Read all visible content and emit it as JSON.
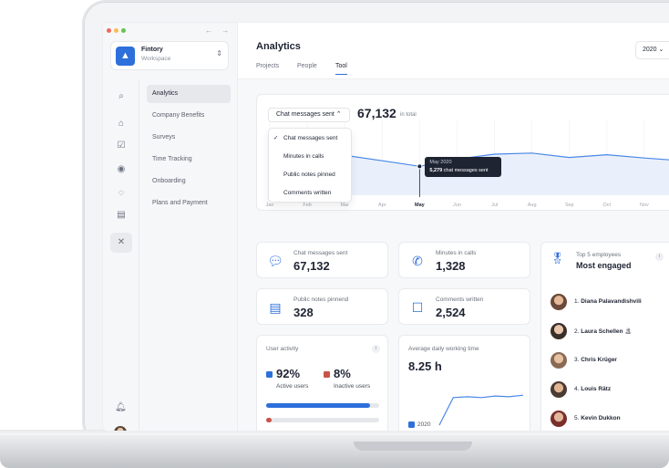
{
  "window": {
    "nav_arrows": "← →"
  },
  "workspace": {
    "name": "Fintory",
    "subtitle": "Workspace",
    "chevron": "⌃⌄"
  },
  "sidebar": {
    "rail_icons": [
      "search-icon",
      "home-icon",
      "check-icon",
      "user-icon",
      "chat-icon",
      "document-icon",
      "tools-icon"
    ],
    "items": [
      {
        "label": "Analytics",
        "active": true
      },
      {
        "label": "Company Benefits",
        "active": false
      },
      {
        "label": "Surveys",
        "active": false
      },
      {
        "label": "Time Tracking",
        "active": false
      },
      {
        "label": "Onboarding",
        "active": false
      },
      {
        "label": "Plans and Payment",
        "active": false
      }
    ]
  },
  "header": {
    "title": "Analytics",
    "tabs": [
      {
        "label": "Projects",
        "active": false
      },
      {
        "label": "People",
        "active": false
      },
      {
        "label": "Tool",
        "active": true
      }
    ],
    "year": "2020 ⌄"
  },
  "main_chart": {
    "selected_metric": "Chat messages sent ⌃",
    "total_value": "67,132",
    "total_suffix": "in total",
    "dropdown_options": [
      {
        "label": "Chat messages sent",
        "checked": true
      },
      {
        "label": "Minutes in calls",
        "checked": false
      },
      {
        "label": "Public notes pinned",
        "checked": false
      },
      {
        "label": "Comments written",
        "checked": false
      }
    ],
    "tooltip": {
      "date": "May 2020",
      "value": "5,279",
      "text": "chat messages sent"
    }
  },
  "chart_data": {
    "type": "area",
    "categories": [
      "Jan",
      "Feb",
      "Mar",
      "Apr",
      "May",
      "Jun",
      "Jul",
      "Aug",
      "Sep",
      "Oct",
      "Nov",
      "Dec"
    ],
    "values": [
      7600,
      7800,
      7300,
      6300,
      5279,
      6600,
      7500,
      7700,
      6900,
      7400,
      6800,
      6300
    ],
    "highlight": "May",
    "ylim": [
      0,
      12000
    ],
    "colors": {
      "line": "#4a88e6",
      "fill": "#eaf0fb"
    }
  },
  "stats": [
    {
      "label": "Chat messages sent",
      "value": "67,132",
      "icon": "chat-bubble-icon"
    },
    {
      "label": "Minutes in calls",
      "value": "1,328",
      "icon": "phone-icon"
    },
    {
      "label": "Public notes pinnend",
      "value": "328",
      "icon": "note-icon"
    },
    {
      "label": "Comments written",
      "value": "2,524",
      "icon": "comment-icon"
    }
  ],
  "user_activity": {
    "title": "User activity",
    "active": {
      "value": "92%",
      "label": "Active users",
      "fraction": 0.92,
      "color": "#2d6fdb"
    },
    "inactive": {
      "value": "8%",
      "label": "Inactive users",
      "fraction": 0.05,
      "color": "#c9534a"
    }
  },
  "working_time": {
    "title": "Average daily working time",
    "value": "8.25 h",
    "legend": "2020",
    "trend": [
      0.0,
      0.72,
      0.74,
      0.72,
      0.76,
      0.74,
      0.78
    ]
  },
  "employees": {
    "title": "Top 5 employees",
    "subtitle": "Most engaged",
    "list": [
      {
        "rank": "1.",
        "name": "Diana Palavandishvili",
        "emoji": ""
      },
      {
        "rank": "2.",
        "name": "Laura Schellen",
        "emoji": "🏝"
      },
      {
        "rank": "3.",
        "name": "Chris Krüger",
        "emoji": ""
      },
      {
        "rank": "4.",
        "name": "Louis Rätz",
        "emoji": ""
      },
      {
        "rank": "5.",
        "name": "Kevin Dukkon",
        "emoji": ""
      }
    ]
  },
  "colors": {
    "accent": "#2d6fdb",
    "danger": "#c9534a"
  }
}
